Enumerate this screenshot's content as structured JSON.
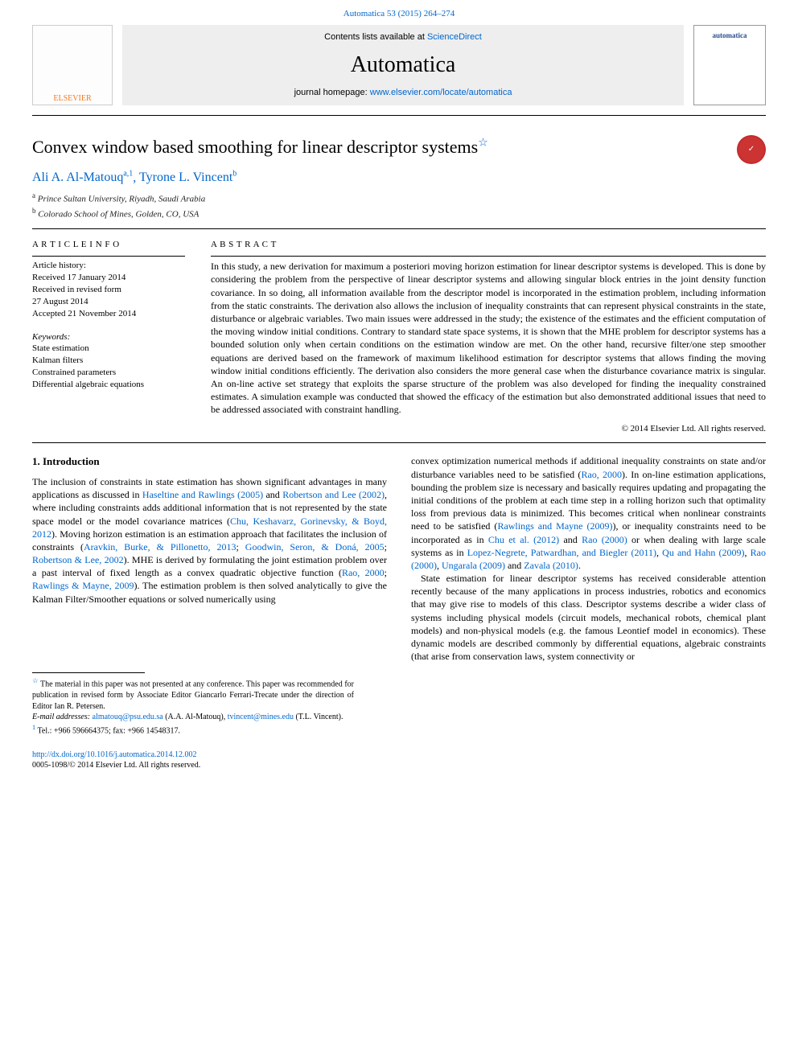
{
  "header": {
    "citation": "Automatica 53 (2015) 264–274",
    "contents_prefix": "Contents lists available at ",
    "contents_link": "ScienceDirect",
    "journal_name": "Automatica",
    "homepage_prefix": "journal homepage: ",
    "homepage_link": "www.elsevier.com/locate/automatica",
    "elsevier_label": "ELSEVIER",
    "cover_label": "automatica"
  },
  "paper": {
    "title": "Convex window based smoothing for linear descriptor systems",
    "title_note_mark": "☆",
    "authors": [
      {
        "name": "Ali A. Al-Matouq",
        "marks": "a,1"
      },
      {
        "name": "Tyrone L. Vincent",
        "marks": "b"
      }
    ],
    "affiliations": [
      {
        "mark": "a",
        "text": "Prince Sultan University, Riyadh, Saudi Arabia"
      },
      {
        "mark": "b",
        "text": "Colorado School of Mines, Golden, CO, USA"
      }
    ]
  },
  "article_info": {
    "heading": "A R T I C L E   I N F O",
    "history": [
      "Article history:",
      "Received 17 January 2014",
      "Received in revised form",
      "27 August 2014",
      "Accepted 21 November 2014"
    ],
    "keywords_head": "Keywords:",
    "keywords": [
      "State estimation",
      "Kalman filters",
      "Constrained parameters",
      "Differential algebraic equations"
    ]
  },
  "abstract": {
    "heading": "A B S T R A C T",
    "text": "In this study, a new derivation for maximum a posteriori moving horizon estimation for linear descriptor systems is developed. This is done by considering the problem from the perspective of linear descriptor systems and allowing singular block entries in the joint density function covariance. In so doing, all information available from the descriptor model is incorporated in the estimation problem, including information from the static constraints. The derivation also allows the inclusion of inequality constraints that can represent physical constraints in the state, disturbance or algebraic variables. Two main issues were addressed in the study; the existence of the estimates and the efficient computation of the moving window initial conditions. Contrary to standard state space systems, it is shown that the MHE problem for descriptor systems has a bounded solution only when certain conditions on the estimation window are met. On the other hand, recursive filter/one step smoother equations are derived based on the framework of maximum likelihood estimation for descriptor systems that allows finding the moving window initial conditions efficiently. The derivation also considers the more general case when the disturbance covariance matrix is singular. An on-line active set strategy that exploits the sparse structure of the problem was also developed for finding the inequality constrained estimates. A simulation example was conducted that showed the efficacy of the estimation but also demonstrated additional issues that need to be addressed associated with constraint handling.",
    "copyright": "© 2014 Elsevier Ltd. All rights reserved."
  },
  "body": {
    "section_number": "1.",
    "section_title": "Introduction",
    "col1_parts": [
      "The inclusion of constraints in state estimation has shown significant advantages in many applications as discussed in ",
      {
        "ref": "Haseltine and Rawlings (2005)"
      },
      " and ",
      {
        "ref": "Robertson and Lee (2002)"
      },
      ", where including constraints adds additional information that is not represented by the state space model or the model covariance matrices (",
      {
        "ref": "Chu, Keshavarz, Gorinevsky, & Boyd, 2012"
      },
      "). Moving horizon estimation is an estimation approach that facilitates the inclusion of constraints (",
      {
        "ref": "Aravkin, Burke, & Pillonetto, 2013"
      },
      "; ",
      {
        "ref": "Goodwin, Seron, & Doná, 2005"
      },
      "; ",
      {
        "ref": "Robertson & Lee, 2002"
      },
      "). MHE is derived by formulating the joint estimation problem over a past interval of fixed length as a convex quadratic objective function (",
      {
        "ref": "Rao, 2000"
      },
      "; ",
      {
        "ref": "Rawlings & Mayne, 2009"
      },
      "). The estimation problem is then solved analytically to give the Kalman Filter/Smoother equations or solved numerically using"
    ],
    "col2_parts": [
      "convex optimization numerical methods if additional inequality constraints on state and/or disturbance variables need to be satisfied (",
      {
        "ref": "Rao, 2000"
      },
      "). In on-line estimation applications, bounding the problem size is necessary and basically requires updating and propagating the initial conditions of the problem at each time step in a rolling horizon such that optimality loss from previous data is minimized. This becomes critical when nonlinear constraints need to be satisfied (",
      {
        "ref": "Rawlings and Mayne (2009)"
      },
      "), or inequality constraints need to be incorporated as in ",
      {
        "ref": "Chu et al. (2012)"
      },
      " and ",
      {
        "ref": "Rao (2000)"
      },
      " or when dealing with large scale systems as in ",
      {
        "ref": "Lopez-Negrete, Patwardhan, and Biegler (2011)"
      },
      ", ",
      {
        "ref": "Qu and Hahn (2009)"
      },
      ", ",
      {
        "ref": "Rao (2000)"
      },
      ", ",
      {
        "ref": "Ungarala (2009)"
      },
      " and ",
      {
        "ref": "Zavala (2010)"
      },
      ".",
      {
        "br": true
      },
      "State estimation for linear descriptor systems has received considerable attention recently because of the many applications in process industries, robotics and economics that may give rise to models of this class. Descriptor systems describe a wider class of systems including physical models (circuit models, mechanical robots, chemical plant models) and non-physical models (e.g. the famous Leontief model in economics). These dynamic models are described commonly by differential equations, algebraic constraints (that arise from conservation laws, system connectivity or"
    ]
  },
  "footnotes": {
    "star": {
      "mark": "☆",
      "text": " The material in this paper was not presented at any conference. This paper was recommended for publication in revised form by Associate Editor Giancarlo Ferrari-Trecate under the direction of Editor Ian R. Petersen."
    },
    "emails_label": "E-mail addresses:",
    "emails": [
      {
        "addr": "almatouq@psu.edu.sa",
        "who": "(A.A. Al-Matouq)"
      },
      {
        "addr": "tvincent@mines.edu",
        "who": "(T.L. Vincent)"
      }
    ],
    "tel": {
      "mark": "1",
      "text": " Tel.: +966 596664375; fax: +966 14548317."
    }
  },
  "doi": {
    "link": "http://dx.doi.org/10.1016/j.automatica.2014.12.002",
    "line2": "0005-1098/© 2014 Elsevier Ltd. All rights reserved."
  }
}
